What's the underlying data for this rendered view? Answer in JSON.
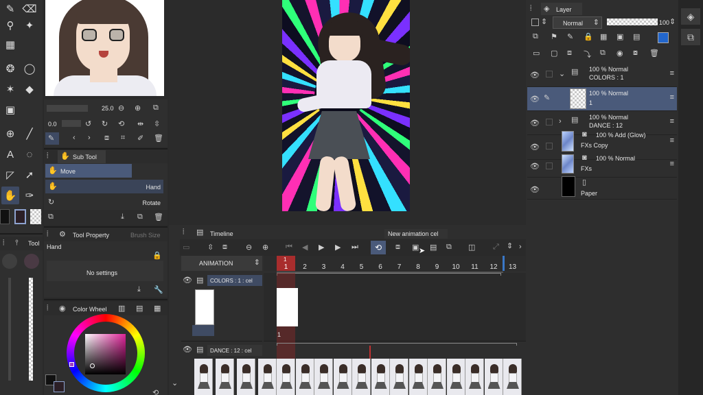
{
  "tools": {
    "size_value": "25.0",
    "opacity_value": "0.0"
  },
  "sub_tool": {
    "title": "Sub Tool",
    "items": [
      {
        "label": "Move"
      },
      {
        "label": "Hand"
      },
      {
        "label": "Rotate"
      }
    ]
  },
  "tool_property": {
    "title": "Tool Property",
    "tab2": "Brush Size",
    "tool_name": "Hand",
    "empty_message": "No settings",
    "left_tab_label": "Tool"
  },
  "color_wheel": {
    "title": "Color Wheel",
    "selected_color": "#c46aa6"
  },
  "layer_panel": {
    "title": "Layer",
    "blend_mode": "Normal",
    "opacity": "100",
    "layers": [
      {
        "name": "COLORS : 1",
        "info": "100 % Normal",
        "type": "folder"
      },
      {
        "name": "1",
        "info": "100 % Normal",
        "type": "cel",
        "selected": true
      },
      {
        "name": "DANCE : 12",
        "info": "100 % Normal",
        "type": "folder"
      },
      {
        "name": "FXs Copy",
        "info": "100 % Add (Glow)",
        "type": "fx"
      },
      {
        "name": "FXs",
        "info": "100 % Normal",
        "type": "fx"
      },
      {
        "name": "Paper",
        "info": "",
        "type": "paper"
      }
    ]
  },
  "timeline": {
    "title": "Timeline",
    "tooltip": "New animation cel",
    "animation_label": "ANIMATION",
    "frame_numbers": [
      "1",
      "2",
      "3",
      "4",
      "5",
      "6",
      "7",
      "8",
      "9",
      "10",
      "11",
      "12",
      "13"
    ],
    "current_frame": "1",
    "tracks": [
      {
        "name": "COLORS : 1 : cel",
        "cel_label": "1"
      },
      {
        "name": "DANCE : 12 : cel",
        "cel_label": ""
      }
    ]
  },
  "colors": {
    "accent_selected": "#4a5a7a",
    "playhead": "#b03030",
    "panel": "#333333"
  }
}
